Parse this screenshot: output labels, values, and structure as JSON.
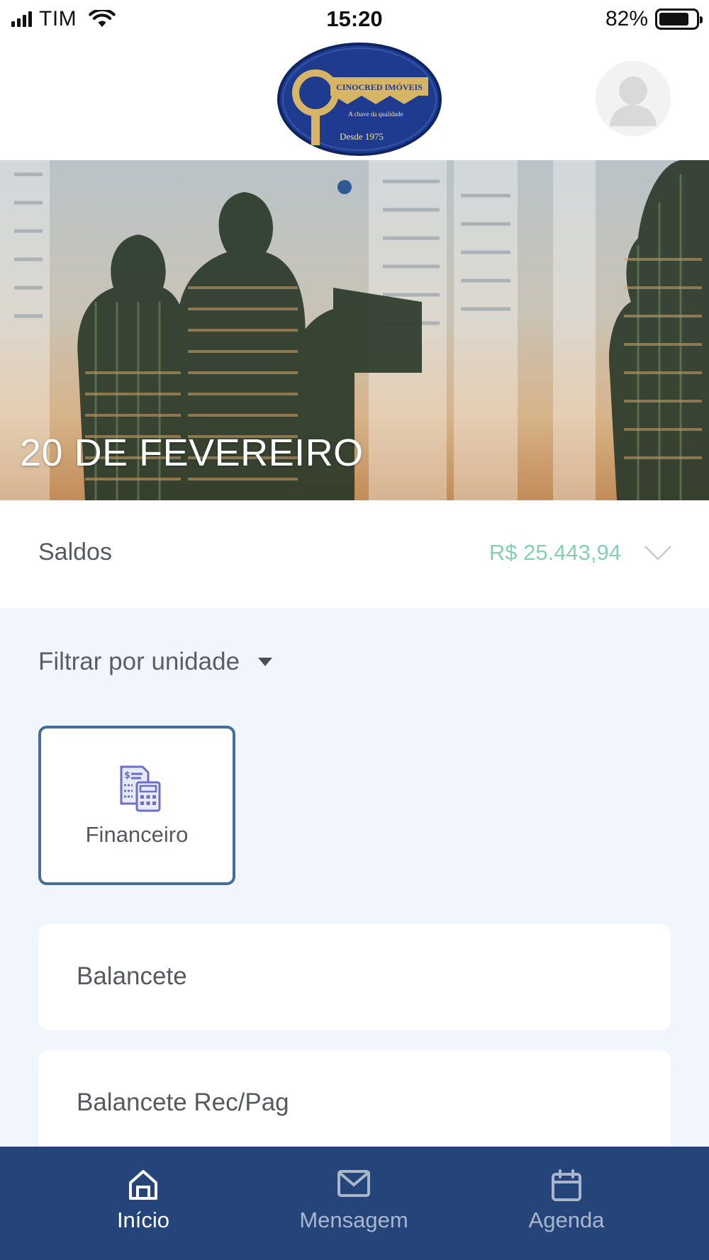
{
  "status_bar": {
    "carrier": "TIM",
    "time": "15:20",
    "battery_percent": "82%",
    "battery_level": 0.82
  },
  "header": {
    "logo": {
      "brand": "CINOCRED IMÓVEIS",
      "tagline": "A chave da qualidade",
      "since": "Desde 1975"
    },
    "avatar_icon": "user-avatar-icon"
  },
  "banner": {
    "date_label": "20 DE FEVEREIRO",
    "active_slide": 1
  },
  "saldos": {
    "label": "Saldos",
    "value": "R$ 25.443,94",
    "value_color": "#86cfb4"
  },
  "filter": {
    "label": "Filtrar por unidade"
  },
  "category_card": {
    "label": "Financeiro",
    "icon": "financial-report-icon",
    "border_color": "#456d9c"
  },
  "reports": [
    {
      "label": "Balancete"
    },
    {
      "label": "Balancete Rec/Pag"
    }
  ],
  "bottom_nav": {
    "background": "#24447a",
    "items": [
      {
        "label": "Início",
        "icon": "home-icon",
        "active": true
      },
      {
        "label": "Mensagem",
        "icon": "envelope-icon",
        "active": false
      },
      {
        "label": "Agenda",
        "icon": "calendar-icon",
        "active": false
      }
    ]
  }
}
